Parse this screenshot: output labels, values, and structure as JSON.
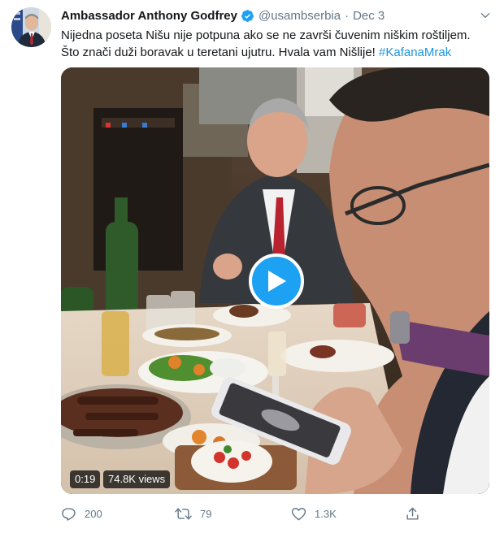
{
  "tweet": {
    "author_name": "Ambassador Anthony Godfrey",
    "handle": "@usambserbia",
    "separator": "·",
    "date": "Dec 3",
    "text_line1": "Nijedna poseta Nišu nije potpuna ako se ne završi čuvenim niškim roštiljem.",
    "text_line2": "Što znači duži boravak u teretani ujutru. Hvala vam Nišlije! ",
    "hashtag": "#KafanaMrak",
    "video": {
      "duration": "0:19",
      "views": "74.8K views"
    },
    "actions": {
      "replies": "200",
      "retweets": "79",
      "likes": "1.3K"
    }
  },
  "colors": {
    "link": "#1b95e0",
    "play_button": "#1da1f2",
    "muted": "#657786"
  },
  "icons": [
    "verified-badge-icon",
    "chevron-down-icon",
    "play-icon",
    "reply-icon",
    "retweet-icon",
    "like-icon",
    "share-icon"
  ]
}
